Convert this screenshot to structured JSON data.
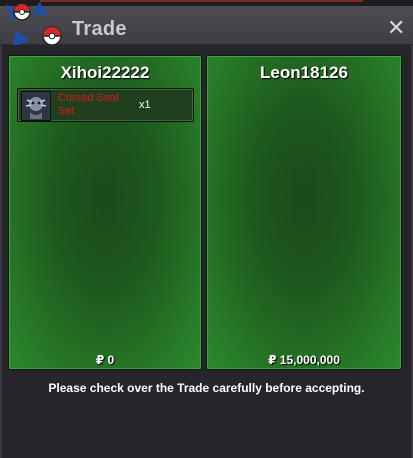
{
  "window": {
    "title": "Trade",
    "close_glyph": "✕"
  },
  "left_panel": {
    "player_name": "Xihoi22222",
    "money": "₽ 0",
    "items": [
      {
        "name": "Cursed Seal Set",
        "quantity": "x1",
        "icon": "cursed-seal-icon"
      }
    ]
  },
  "right_panel": {
    "player_name": "Leon18126",
    "money": "₽ 15,000,000",
    "items": []
  },
  "footer": {
    "message": "Please check over the Trade carefully before accepting."
  },
  "colors": {
    "panel_green": "#2d8a2d",
    "item_name_red": "#e01818",
    "title_text": "#c9c9cf"
  }
}
